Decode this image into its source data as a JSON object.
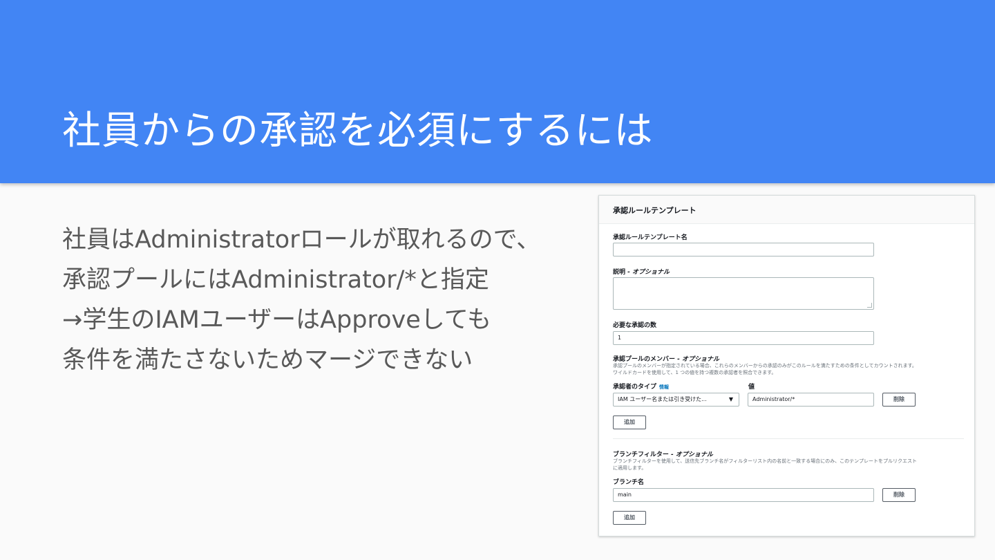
{
  "slide": {
    "title": "社員からの承認を必須にするには",
    "lines": [
      "社員はAdministratorロールが取れるので、",
      "承認プールにはAdministrator/*と指定",
      "→学生のIAMユーザーはApproveしても",
      "条件を満たさないためマージできない"
    ]
  },
  "panel": {
    "title": "承認ルールテンプレート",
    "template_name": {
      "label": "承認ルールテンプレート名",
      "value": ""
    },
    "description": {
      "label": "説明",
      "optional": "- オプショナル",
      "value": ""
    },
    "required_approvals": {
      "label": "必要な承認の数",
      "value": "1"
    },
    "pool_members": {
      "label": "承認プールのメンバー",
      "optional": "- オプショナル",
      "desc_line1": "承認プールのメンバーが指定されている場合、これらのメンバーからの承認のみがこのルールを満たすための条件としてカウントされます。",
      "desc_line2": "ワイルドカードを使用して、1 つの値を持つ複数の承認者を照合できます。",
      "approver_type_label": "承認者のタイプ",
      "info_link": "情報",
      "value_label": "値",
      "approver_type_value": "IAM ユーザー名または引き受けた...",
      "value": "Administrator/*",
      "delete_label": "削除",
      "add_label": "追加"
    },
    "branch_filter": {
      "label": "ブランチフィルター",
      "optional": "- オプショナル",
      "desc_line1": "ブランチフィルターを使用して、送信先ブランチ名がフィルターリスト内の名前と一致する場合にのみ、このテンプレートをプルリクエスト",
      "desc_line2": "に適用します。",
      "branch_name_label": "ブランチ名",
      "branch_value": "main",
      "delete_label": "削除",
      "add_label": "追加"
    }
  },
  "colors": {
    "header": "#4285f4",
    "body_text": "#595959",
    "link": "#0073bb"
  }
}
